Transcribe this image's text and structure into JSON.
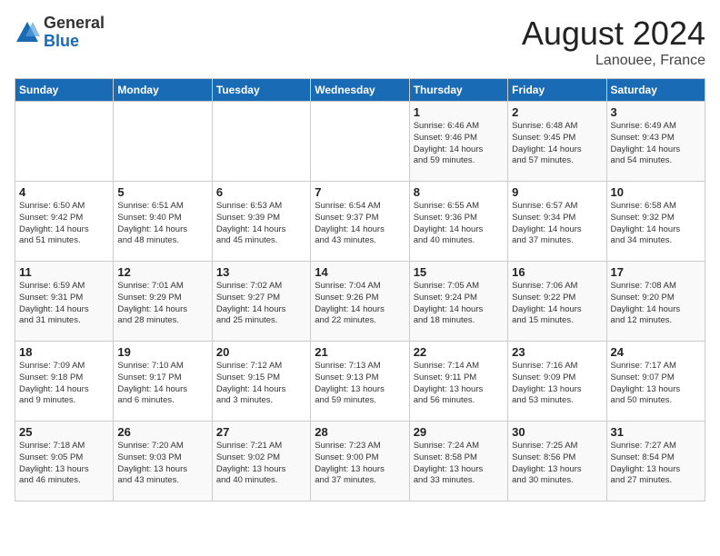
{
  "logo": {
    "general": "General",
    "blue": "Blue"
  },
  "title": "August 2024",
  "location": "Lanouee, France",
  "days_of_week": [
    "Sunday",
    "Monday",
    "Tuesday",
    "Wednesday",
    "Thursday",
    "Friday",
    "Saturday"
  ],
  "weeks": [
    [
      {
        "day": "",
        "info": ""
      },
      {
        "day": "",
        "info": ""
      },
      {
        "day": "",
        "info": ""
      },
      {
        "day": "",
        "info": ""
      },
      {
        "day": "1",
        "info": "Sunrise: 6:46 AM\nSunset: 9:46 PM\nDaylight: 14 hours\nand 59 minutes."
      },
      {
        "day": "2",
        "info": "Sunrise: 6:48 AM\nSunset: 9:45 PM\nDaylight: 14 hours\nand 57 minutes."
      },
      {
        "day": "3",
        "info": "Sunrise: 6:49 AM\nSunset: 9:43 PM\nDaylight: 14 hours\nand 54 minutes."
      }
    ],
    [
      {
        "day": "4",
        "info": "Sunrise: 6:50 AM\nSunset: 9:42 PM\nDaylight: 14 hours\nand 51 minutes."
      },
      {
        "day": "5",
        "info": "Sunrise: 6:51 AM\nSunset: 9:40 PM\nDaylight: 14 hours\nand 48 minutes."
      },
      {
        "day": "6",
        "info": "Sunrise: 6:53 AM\nSunset: 9:39 PM\nDaylight: 14 hours\nand 45 minutes."
      },
      {
        "day": "7",
        "info": "Sunrise: 6:54 AM\nSunset: 9:37 PM\nDaylight: 14 hours\nand 43 minutes."
      },
      {
        "day": "8",
        "info": "Sunrise: 6:55 AM\nSunset: 9:36 PM\nDaylight: 14 hours\nand 40 minutes."
      },
      {
        "day": "9",
        "info": "Sunrise: 6:57 AM\nSunset: 9:34 PM\nDaylight: 14 hours\nand 37 minutes."
      },
      {
        "day": "10",
        "info": "Sunrise: 6:58 AM\nSunset: 9:32 PM\nDaylight: 14 hours\nand 34 minutes."
      }
    ],
    [
      {
        "day": "11",
        "info": "Sunrise: 6:59 AM\nSunset: 9:31 PM\nDaylight: 14 hours\nand 31 minutes."
      },
      {
        "day": "12",
        "info": "Sunrise: 7:01 AM\nSunset: 9:29 PM\nDaylight: 14 hours\nand 28 minutes."
      },
      {
        "day": "13",
        "info": "Sunrise: 7:02 AM\nSunset: 9:27 PM\nDaylight: 14 hours\nand 25 minutes."
      },
      {
        "day": "14",
        "info": "Sunrise: 7:04 AM\nSunset: 9:26 PM\nDaylight: 14 hours\nand 22 minutes."
      },
      {
        "day": "15",
        "info": "Sunrise: 7:05 AM\nSunset: 9:24 PM\nDaylight: 14 hours\nand 18 minutes."
      },
      {
        "day": "16",
        "info": "Sunrise: 7:06 AM\nSunset: 9:22 PM\nDaylight: 14 hours\nand 15 minutes."
      },
      {
        "day": "17",
        "info": "Sunrise: 7:08 AM\nSunset: 9:20 PM\nDaylight: 14 hours\nand 12 minutes."
      }
    ],
    [
      {
        "day": "18",
        "info": "Sunrise: 7:09 AM\nSunset: 9:18 PM\nDaylight: 14 hours\nand 9 minutes."
      },
      {
        "day": "19",
        "info": "Sunrise: 7:10 AM\nSunset: 9:17 PM\nDaylight: 14 hours\nand 6 minutes."
      },
      {
        "day": "20",
        "info": "Sunrise: 7:12 AM\nSunset: 9:15 PM\nDaylight: 14 hours\nand 3 minutes."
      },
      {
        "day": "21",
        "info": "Sunrise: 7:13 AM\nSunset: 9:13 PM\nDaylight: 13 hours\nand 59 minutes."
      },
      {
        "day": "22",
        "info": "Sunrise: 7:14 AM\nSunset: 9:11 PM\nDaylight: 13 hours\nand 56 minutes."
      },
      {
        "day": "23",
        "info": "Sunrise: 7:16 AM\nSunset: 9:09 PM\nDaylight: 13 hours\nand 53 minutes."
      },
      {
        "day": "24",
        "info": "Sunrise: 7:17 AM\nSunset: 9:07 PM\nDaylight: 13 hours\nand 50 minutes."
      }
    ],
    [
      {
        "day": "25",
        "info": "Sunrise: 7:18 AM\nSunset: 9:05 PM\nDaylight: 13 hours\nand 46 minutes."
      },
      {
        "day": "26",
        "info": "Sunrise: 7:20 AM\nSunset: 9:03 PM\nDaylight: 13 hours\nand 43 minutes."
      },
      {
        "day": "27",
        "info": "Sunrise: 7:21 AM\nSunset: 9:02 PM\nDaylight: 13 hours\nand 40 minutes."
      },
      {
        "day": "28",
        "info": "Sunrise: 7:23 AM\nSunset: 9:00 PM\nDaylight: 13 hours\nand 37 minutes."
      },
      {
        "day": "29",
        "info": "Sunrise: 7:24 AM\nSunset: 8:58 PM\nDaylight: 13 hours\nand 33 minutes."
      },
      {
        "day": "30",
        "info": "Sunrise: 7:25 AM\nSunset: 8:56 PM\nDaylight: 13 hours\nand 30 minutes."
      },
      {
        "day": "31",
        "info": "Sunrise: 7:27 AM\nSunset: 8:54 PM\nDaylight: 13 hours\nand 27 minutes."
      }
    ]
  ]
}
